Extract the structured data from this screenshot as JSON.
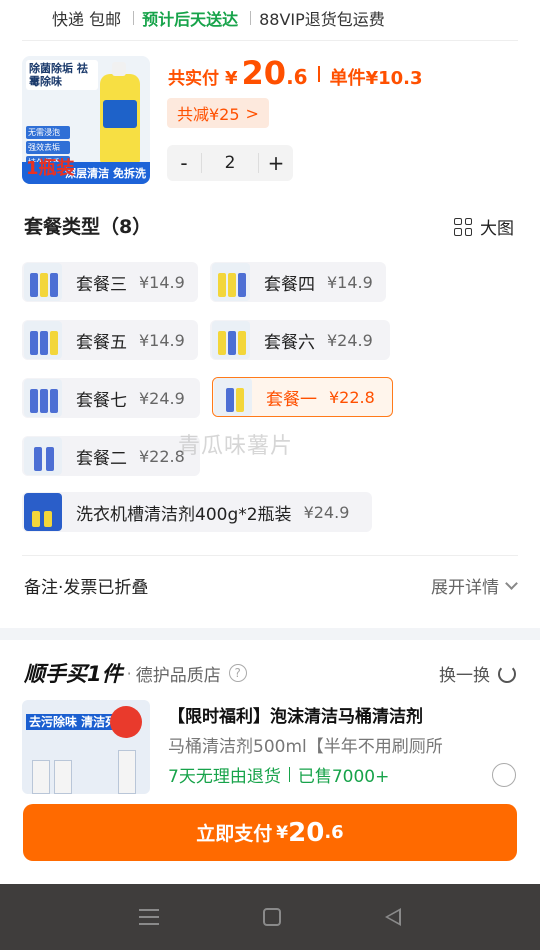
{
  "shipping": {
    "express": "快递 包邮",
    "delivery": "预计后天送达",
    "vip": "88VIP退货包运费"
  },
  "product": {
    "image_header": "除菌除垢 祛霉除味",
    "image_tags": [
      "无需浸泡",
      "强效去垢",
      "持久留香"
    ],
    "image_count": "1瓶装",
    "image_footer": "深层清洁 免拆洗"
  },
  "price": {
    "total_label": "共实付",
    "currency": "¥",
    "total_int": "20",
    "total_dec": ".6",
    "unit_label": "单件¥10.3",
    "discount_label": "共减¥25",
    "discount_arrow": ">"
  },
  "quantity": {
    "minus": "-",
    "value": "2",
    "plus": "+"
  },
  "package": {
    "title": "套餐类型（8）",
    "big_view": "大图",
    "options": [
      {
        "name": "套餐三",
        "price": "¥14.9",
        "selected": false
      },
      {
        "name": "套餐四",
        "price": "¥14.9",
        "selected": false
      },
      {
        "name": "套餐五",
        "price": "¥14.9",
        "selected": false
      },
      {
        "name": "套餐六",
        "price": "¥24.9",
        "selected": false
      },
      {
        "name": "套餐七",
        "price": "¥24.9",
        "selected": false
      },
      {
        "name": "套餐一",
        "price": "¥22.8",
        "selected": true
      },
      {
        "name": "套餐二",
        "price": "¥22.8",
        "selected": false
      },
      {
        "name": "洗衣机槽清洁剂400g*2瓶装",
        "price": "¥24.9",
        "selected": false
      }
    ]
  },
  "watermark": "青瓜味薯片",
  "notes": {
    "label": "备注·发票已折叠",
    "expand": "展开详情"
  },
  "addon": {
    "title": "顺手买1件",
    "subtitle": "德护品质店",
    "help": "?",
    "swap": "换一换",
    "image_text": "去污除味 清洁死角",
    "item_title": "【限时福利】泡沫清洁马桶清洁剂",
    "item_desc": "马桶清洁剂500ml【半年不用刷厕所",
    "return_policy": "7天无理由退货",
    "sold": "已售7000+"
  },
  "pay": {
    "label": "立即支付",
    "currency": "¥",
    "int": "20",
    "dec": ".6"
  },
  "colors": {
    "accent": "#ff5000",
    "pay_button": "#ff6a00",
    "green": "#17a34a",
    "nav_bar": "#3f3d3c"
  }
}
